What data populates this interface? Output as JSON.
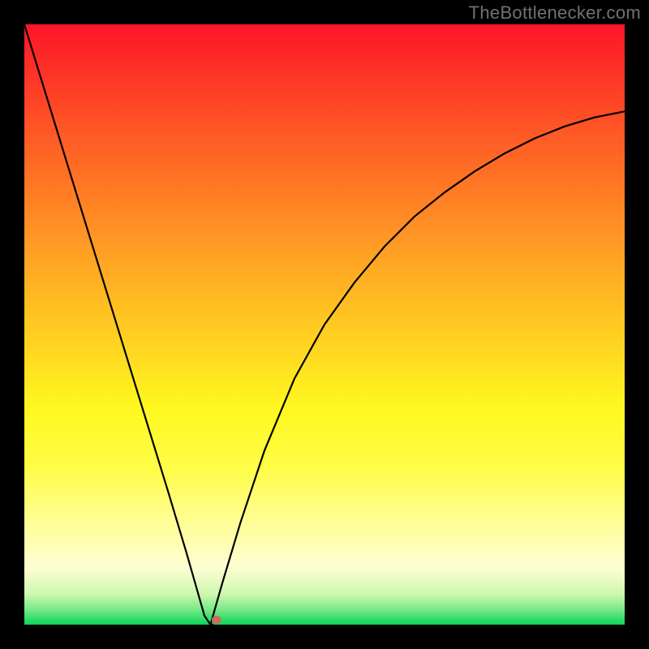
{
  "watermark": "TheBottlenecker.com",
  "chart_data": {
    "type": "line",
    "title": "",
    "xlabel": "",
    "ylabel": "",
    "xlim": [
      0,
      1
    ],
    "ylim": [
      0,
      1
    ],
    "x_cusp": 0.31,
    "marker": {
      "x": 0.32,
      "y": 0.008,
      "color": "#cc6a5c"
    },
    "left_branch": {
      "x": [
        0.0,
        0.04,
        0.08,
        0.12,
        0.16,
        0.2,
        0.24,
        0.27,
        0.29,
        0.3,
        0.31
      ],
      "y": [
        1.0,
        0.87,
        0.74,
        0.61,
        0.48,
        0.35,
        0.22,
        0.12,
        0.05,
        0.015,
        0.0
      ]
    },
    "right_branch": {
      "x": [
        0.31,
        0.33,
        0.36,
        0.4,
        0.45,
        0.5,
        0.55,
        0.6,
        0.65,
        0.7,
        0.75,
        0.8,
        0.85,
        0.9,
        0.95,
        1.0
      ],
      "y": [
        0.0,
        0.07,
        0.17,
        0.29,
        0.41,
        0.5,
        0.57,
        0.63,
        0.68,
        0.72,
        0.755,
        0.785,
        0.81,
        0.83,
        0.845,
        0.855
      ]
    },
    "gradient_stops": [
      {
        "offset": 0.0,
        "color": "#fc1528"
      },
      {
        "offset": 0.07,
        "color": "#fd2f27"
      },
      {
        "offset": 0.18,
        "color": "#fe5826"
      },
      {
        "offset": 0.3,
        "color": "#ff8324"
      },
      {
        "offset": 0.42,
        "color": "#ffae23"
      },
      {
        "offset": 0.53,
        "color": "#ffd321"
      },
      {
        "offset": 0.64,
        "color": "#fff820"
      },
      {
        "offset": 0.74,
        "color": "#fffd48"
      },
      {
        "offset": 0.83,
        "color": "#fffe97"
      },
      {
        "offset": 0.905,
        "color": "#fffed3"
      },
      {
        "offset": 0.95,
        "color": "#ccf7af"
      },
      {
        "offset": 0.975,
        "color": "#77e987"
      },
      {
        "offset": 1.0,
        "color": "#0ad45a"
      }
    ]
  }
}
